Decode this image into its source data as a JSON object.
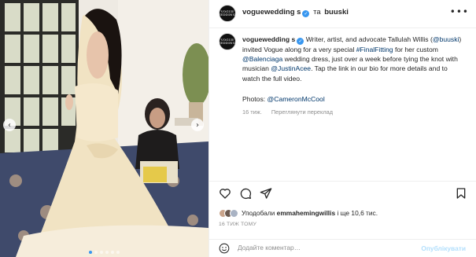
{
  "post": {
    "author": "voguewedding s",
    "collab_connector": "та",
    "collaborator": "buuski",
    "avatar_text": "VOGUE WEDDINGS",
    "more_icon": "more-horizontal-icon"
  },
  "caption": {
    "author": "voguewedding s",
    "segments": [
      {
        "text": " Writer, artist, and advocate Tallulah Willis (",
        "type": "text"
      },
      {
        "text": "@buuski",
        "type": "link"
      },
      {
        "text": ") invited Vogue along for a very special ",
        "type": "text"
      },
      {
        "text": "#FinalFitting",
        "type": "link"
      },
      {
        "text": " for her custom ",
        "type": "text"
      },
      {
        "text": "@Balenciaga",
        "type": "link"
      },
      {
        "text": " wedding dress, just over a week before tying the knot with musician ",
        "type": "text"
      },
      {
        "text": "@JustinAcee",
        "type": "link"
      },
      {
        "text": ". Tap the link in our bio for more details and to watch the full video.",
        "type": "text"
      }
    ],
    "photos_label": "Photos: ",
    "photos_credit": "@CameronMcCool",
    "age": "16 тиж.",
    "translate": "Переглянути переклад"
  },
  "actions": {
    "icons": [
      "heart-icon",
      "comment-icon",
      "share-icon",
      "bookmark-icon"
    ]
  },
  "likes": {
    "prefix": "Уподобали ",
    "user": "emmahemingwillis",
    "suffix": " і ще 10,6 тис."
  },
  "timestamp": "16 ТИЖ ТОМУ",
  "comment": {
    "placeholder": "Додайте коментар…",
    "publish": "Опублікувати"
  },
  "carousel": {
    "slides": 6,
    "active_index": 0
  },
  "colors": {
    "verified": "#3897f0",
    "link": "#00376b",
    "muted": "#8e8e8e",
    "publish_disabled": "#b2dffc"
  }
}
